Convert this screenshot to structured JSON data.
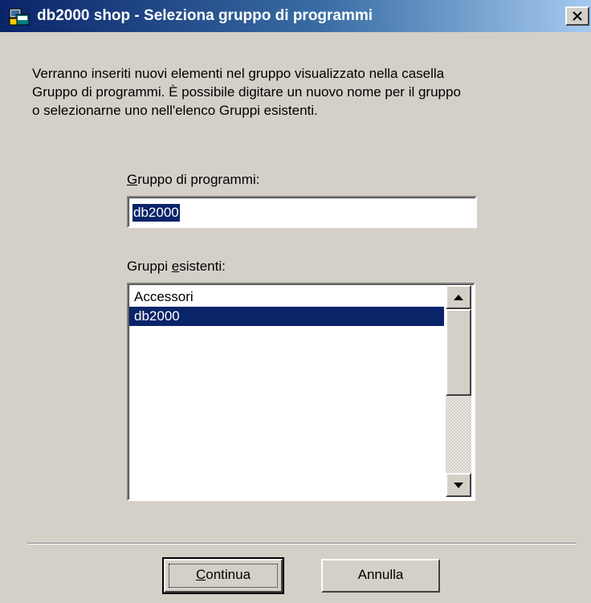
{
  "window": {
    "title": "db2000 shop - Seleziona gruppo di programmi",
    "icon": "setup-program-icon",
    "close_symbol": "close-icon"
  },
  "description": "Verranno inseriti nuovi elementi nel gruppo visualizzato nella casella\nGruppo di programmi. È possibile digitare un nuovo nome per il gruppo\no selezionarne uno nell'elenco Gruppi esistenti.",
  "program_group": {
    "label_mnemonic": "G",
    "label_rest": "ruppo di programmi:",
    "value": "db2000"
  },
  "existing_groups": {
    "label_before": "Gruppi ",
    "label_mnemonic": "e",
    "label_after": "sistenti:",
    "items": [
      "Accessori",
      "db2000"
    ],
    "selected_index": 1
  },
  "buttons": {
    "continue_mnemonic": "C",
    "continue_rest": "ontinua",
    "cancel": "Annulla"
  },
  "colors": {
    "selection": "#0a246a",
    "dialog_face": "#d4d0c8"
  }
}
